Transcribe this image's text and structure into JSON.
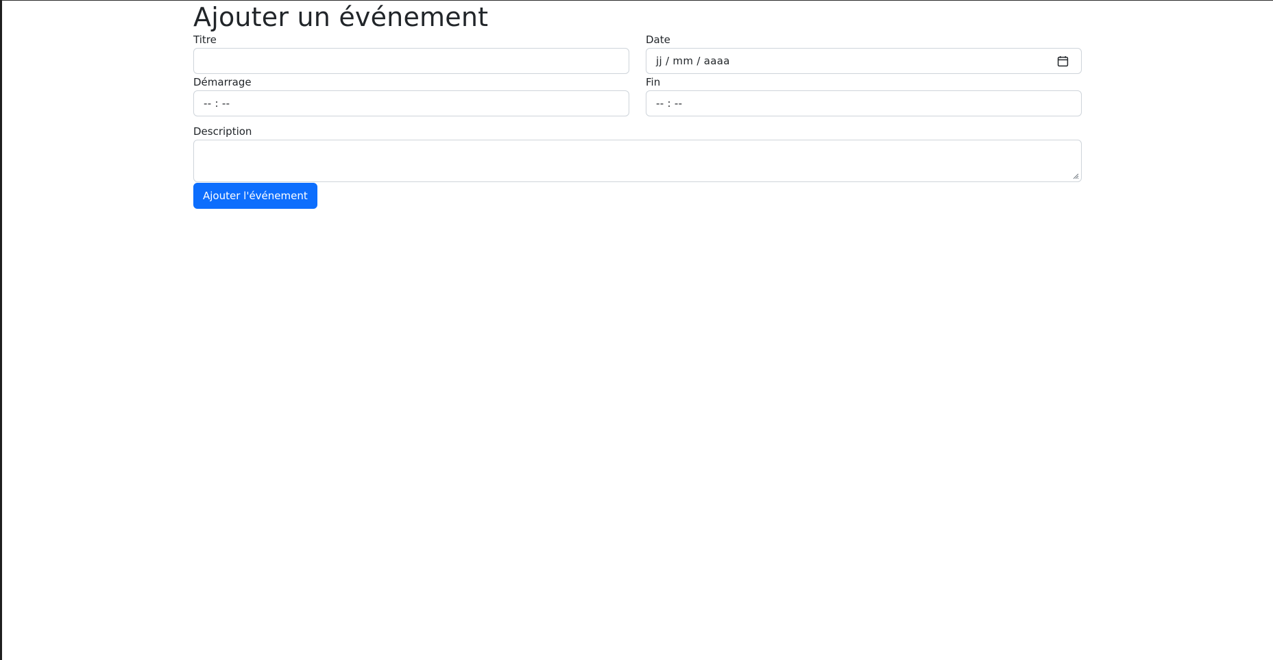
{
  "page": {
    "title": "Ajouter un événement"
  },
  "form": {
    "title_field": {
      "label": "Titre",
      "value": ""
    },
    "date_field": {
      "label": "Date",
      "placeholder": "jj / mm / aaaa",
      "icon": "calendar-icon"
    },
    "start_field": {
      "label": "Démarrage",
      "placeholder": "-- : --"
    },
    "end_field": {
      "label": "Fin",
      "placeholder": "-- : --"
    },
    "description_field": {
      "label": "Description",
      "value": ""
    },
    "submit_label": "Ajouter l'événement"
  },
  "colors": {
    "primary": "#0d6efd",
    "text": "#212529",
    "border": "#ced4da"
  }
}
